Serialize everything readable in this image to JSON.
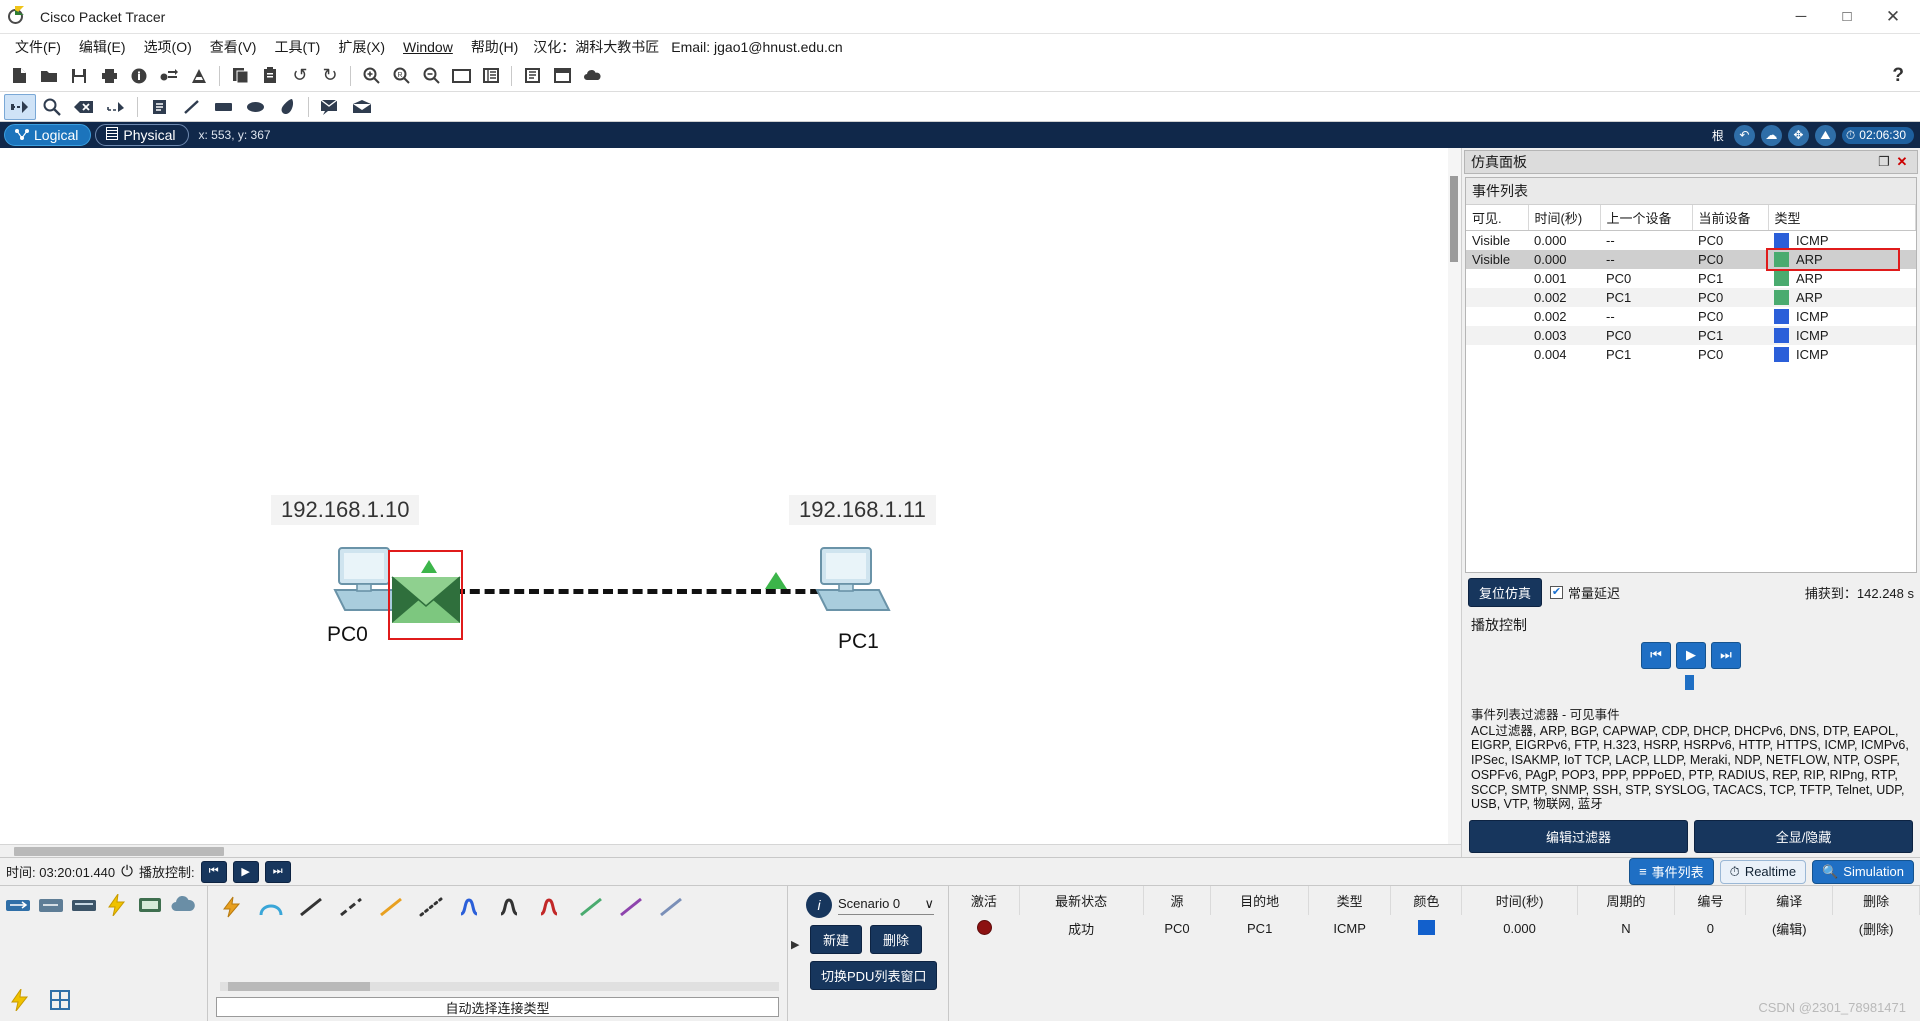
{
  "window": {
    "title": "Cisco Packet Tracer",
    "minimize": "─",
    "maximize": "□",
    "close": "✕"
  },
  "menu": {
    "items": [
      {
        "label": "文件(F)",
        "key": "F"
      },
      {
        "label": "编辑(E)",
        "key": "E"
      },
      {
        "label": "选项(O)",
        "key": "O"
      },
      {
        "label": "查看(V)",
        "key": "V"
      },
      {
        "label": "工具(T)",
        "key": "T"
      },
      {
        "label": "扩展(X)",
        "key": "X"
      },
      {
        "label": "Window",
        "key": "W"
      },
      {
        "label": "帮助(H)",
        "key": "H"
      }
    ],
    "note": "汉化：湖科大教书匠",
    "email": "Email: jgao1@hnust.edu.cn",
    "help_glyph": "?"
  },
  "toolbar_main": {
    "buttons": [
      {
        "name": "new-file-icon",
        "glyph": "📄"
      },
      {
        "name": "open-file-icon",
        "glyph": "📁"
      },
      {
        "name": "save-icon",
        "glyph": "💾"
      },
      {
        "name": "print-icon",
        "glyph": "🖨"
      },
      {
        "name": "activity-wizard-icon",
        "glyph": "ℹ"
      },
      {
        "name": "network-info-icon",
        "glyph": "⇥"
      },
      {
        "name": "drawing-palette-icon",
        "glyph": "◢"
      },
      {
        "name": "copy-icon",
        "glyph": "⧉"
      },
      {
        "name": "paste-icon",
        "glyph": "📋"
      },
      {
        "name": "undo-icon",
        "glyph": "↶"
      },
      {
        "name": "redo-icon",
        "glyph": "↷"
      },
      {
        "name": "zoom-in-icon",
        "glyph": "⊕"
      },
      {
        "name": "zoom-reset-icon",
        "glyph": "Ⓡ"
      },
      {
        "name": "zoom-out-icon",
        "glyph": "⊖"
      },
      {
        "name": "palette-window-icon",
        "glyph": "▭"
      },
      {
        "name": "custom-devices-icon",
        "glyph": "☰"
      },
      {
        "name": "notes-icon",
        "glyph": "≡"
      },
      {
        "name": "workspace-icon",
        "glyph": "☷"
      },
      {
        "name": "cloud-icon",
        "glyph": "☁"
      }
    ]
  },
  "toolbar_tools": {
    "buttons": [
      {
        "name": "select-tool-icon",
        "glyph": "⤡",
        "selected": true
      },
      {
        "name": "inspect-tool-icon",
        "glyph": "🔍",
        "selected": false
      },
      {
        "name": "delete-tool-icon",
        "glyph": "⌫",
        "selected": false
      },
      {
        "name": "resize-shape-icon",
        "glyph": "⤢",
        "selected": false
      },
      {
        "name": "place-note-icon",
        "glyph": "≡",
        "selected": false
      },
      {
        "name": "draw-line-icon",
        "glyph": "╱",
        "selected": false
      },
      {
        "name": "draw-rectangle-icon",
        "glyph": "▬",
        "selected": false
      },
      {
        "name": "draw-ellipse-icon",
        "glyph": "⬬",
        "selected": false
      },
      {
        "name": "draw-freeform-icon",
        "glyph": "◖",
        "selected": false
      },
      {
        "name": "simple-pdu-icon",
        "glyph": "✉",
        "selected": false
      },
      {
        "name": "complex-pdu-icon",
        "glyph": "✉",
        "selected": false
      }
    ]
  },
  "workspace_bar": {
    "logical_tab": "Logical",
    "physical_tab": "Physical",
    "active_tab": "Logical",
    "coords": "x: 553, y: 367",
    "root_label": "根",
    "right_buttons": [
      {
        "name": "back-arrow-icon",
        "glyph": "↶"
      },
      {
        "name": "cloud-view-icon",
        "glyph": "☁"
      },
      {
        "name": "move-object-icon",
        "glyph": "✥"
      },
      {
        "name": "set-tiled-background-icon",
        "glyph": "⛰"
      }
    ],
    "clock": "02:06:30",
    "clock_icon": "⏱"
  },
  "topology": {
    "devices": [
      {
        "name": "PC0",
        "ip": "192.168.1.10"
      },
      {
        "name": "PC1",
        "ip": "192.168.1.11"
      }
    ]
  },
  "sim_panel": {
    "title": "仿真面板",
    "restore_glyph": "❐",
    "close_glyph": "✕",
    "event_list_header": "事件列表",
    "columns": [
      "可见.",
      "时间(秒)",
      "上一个设备",
      "当前设备",
      "类型"
    ],
    "rows": [
      {
        "visible": "Visible",
        "time": "0.000",
        "last": "--",
        "current": "PC0",
        "type": "ICMP",
        "color": "#2b5fd9",
        "selected": false,
        "boxed": false
      },
      {
        "visible": "Visible",
        "time": "0.000",
        "last": "--",
        "current": "PC0",
        "type": "ARP",
        "color": "#4aab6f",
        "selected": true,
        "boxed": true
      },
      {
        "visible": "",
        "time": "0.001",
        "last": "PC0",
        "current": "PC1",
        "type": "ARP",
        "color": "#4aab6f",
        "selected": false,
        "boxed": false
      },
      {
        "visible": "",
        "time": "0.002",
        "last": "PC1",
        "current": "PC0",
        "type": "ARP",
        "color": "#4aab6f",
        "selected": false,
        "boxed": false
      },
      {
        "visible": "",
        "time": "0.002",
        "last": "--",
        "current": "PC0",
        "type": "ICMP",
        "color": "#2b5fd9",
        "selected": false,
        "boxed": false
      },
      {
        "visible": "",
        "time": "0.003",
        "last": "PC0",
        "current": "PC1",
        "type": "ICMP",
        "color": "#2b5fd9",
        "selected": false,
        "boxed": false
      },
      {
        "visible": "",
        "time": "0.004",
        "last": "PC1",
        "current": "PC0",
        "type": "ICMP",
        "color": "#2b5fd9",
        "selected": false,
        "boxed": false
      }
    ],
    "reset_button": "复位仿真",
    "constant_delay_label": "常量延迟",
    "constant_delay_checked": true,
    "captured_label": "捕获到：142.248 s",
    "play_controls_label": "播放控制",
    "play_buttons": [
      {
        "name": "back-to-start-button",
        "glyph": "⏮"
      },
      {
        "name": "play-pause-button",
        "glyph": "▶"
      },
      {
        "name": "step-forward-button",
        "glyph": "⏭"
      }
    ],
    "filter_title": "事件列表过滤器 - 可见事件",
    "filter_text": "ACL过滤器, ARP, BGP, CAPWAP, CDP, DHCP, DHCPv6, DNS, DTP, EAPOL, EIGRP, EIGRPv6, FTP, H.323, HSRP, HSRPv6, HTTP, HTTPS, ICMP, ICMPv6, IPSec, ISAKMP, IoT TCP, LACP, LLDP, Meraki, NDP, NETFLOW, NTP, OSPF, OSPFv6, PAgP, POP3, PPP, PPPoED, PTP, RADIUS, REP, RIP, RIPng, RTP, SCCP, SMTP, SNMP, SSH, STP, SYSLOG, TACACS, TCP, TFTP, Telnet, UDP, USB, VTP, 物联网, 蓝牙",
    "edit_filter_button": "编辑过滤器",
    "show_all_button": "全显/隐藏"
  },
  "time_bar": {
    "time_label": "时间: 03:20:01.440",
    "power_glyph": "⏻",
    "play_label": "播放控制:",
    "buttons": [
      {
        "name": "rewind-button",
        "glyph": "⏮"
      },
      {
        "name": "play-button",
        "glyph": "▶"
      },
      {
        "name": "forward-button",
        "glyph": "⏭"
      }
    ],
    "event_list_chip": "事件列表",
    "event_list_icon": "≡",
    "realtime_chip": "Realtime",
    "realtime_icon": "⏱",
    "simulation_chip": "Simulation",
    "simulation_icon": "🔍",
    "active_mode": "Simulation"
  },
  "device_palette": {
    "row1": [
      {
        "name": "network-devices-icon",
        "glyph": "⇄"
      },
      {
        "name": "routers-icon",
        "glyph": "⊞"
      },
      {
        "name": "switches-icon",
        "glyph": "⬚"
      },
      {
        "name": "connections-icon",
        "glyph": "⚡"
      },
      {
        "name": "end-devices-icon",
        "glyph": "▣"
      },
      {
        "name": "components-icon",
        "glyph": "☁"
      }
    ],
    "row2": [
      {
        "name": "connections-group-icon",
        "glyph": "⚡"
      },
      {
        "name": "grid-group-icon",
        "glyph": "⊞"
      }
    ]
  },
  "connections": {
    "items": [
      {
        "name": "automatic-connection-icon",
        "glyph": "⚡",
        "color": "#e8a020"
      },
      {
        "name": "console-connection-icon",
        "glyph": "⌒",
        "color": "#3aa6d8"
      },
      {
        "name": "copper-straight-icon",
        "glyph": "╱",
        "color": "#333333"
      },
      {
        "name": "copper-crossover-icon",
        "glyph": "╱",
        "color": "#333333"
      },
      {
        "name": "fiber-connection-icon",
        "glyph": "╱",
        "color": "#e8a020"
      },
      {
        "name": "phone-connection-icon",
        "glyph": "⸺",
        "color": "#333333"
      },
      {
        "name": "coaxial-connection-icon",
        "glyph": "∿",
        "color": "#2b5fd9"
      },
      {
        "name": "serial-dce-icon",
        "glyph": "∿",
        "color": "#333333"
      },
      {
        "name": "serial-dte-icon",
        "glyph": "∿",
        "color": "#c22727"
      },
      {
        "name": "octal-connection-icon",
        "glyph": "╱",
        "color": "#4aab6f"
      },
      {
        "name": "iot-custom-cable-icon",
        "glyph": "╱",
        "color": "#8e44ad"
      },
      {
        "name": "usb-connection-icon",
        "glyph": "╱",
        "color": "#7a8fb8"
      }
    ],
    "status_label": "自动选择连接类型"
  },
  "scenario": {
    "icon_glyph": "i",
    "selected": "Scenario 0",
    "dropdown_glyph": "∨",
    "new_button": "新建",
    "delete_button": "删除",
    "toggle_button": "切换PDU列表窗口",
    "arrow_glyph": "▶"
  },
  "pdu_table": {
    "columns": [
      "激活",
      "最新状态",
      "源",
      "目的地",
      "类型",
      "颜色",
      "时间(秒)",
      "周期的",
      "编号",
      "编译",
      "删除"
    ],
    "rows": [
      {
        "fire": "",
        "last_status": "成功",
        "source": "PC0",
        "destination": "PC1",
        "type": "ICMP",
        "color": "#1260cc",
        "time": "0.000",
        "periodic": "N",
        "num": "0",
        "edit": "(编辑)",
        "delete": "(删除)"
      }
    ]
  },
  "watermark": "CSDN @2301_78981471"
}
